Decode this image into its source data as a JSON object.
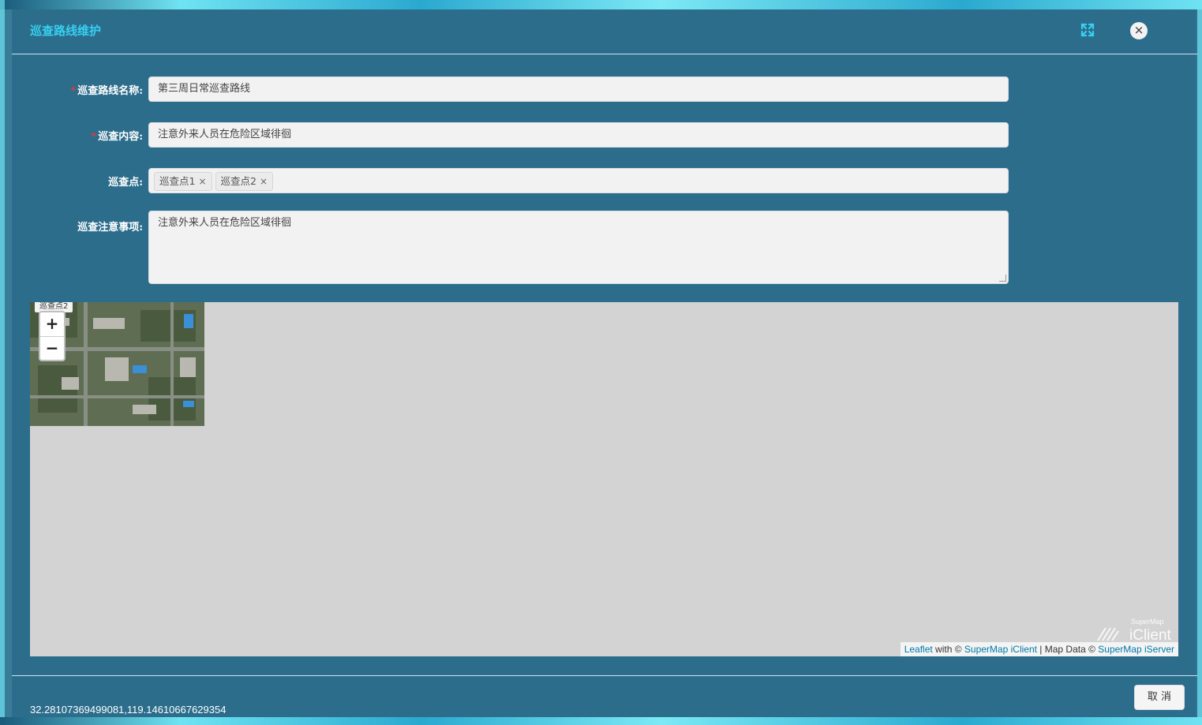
{
  "dialog": {
    "title": "巡查路线维护",
    "fullscreen_icon": "fullscreen-icon",
    "close_icon": "close-icon",
    "close_glyph": "×"
  },
  "form": {
    "route_name": {
      "label": "巡查路线名称:",
      "value": "第三周日常巡查路线",
      "required": true
    },
    "content": {
      "label": "巡查内容:",
      "value": "注意外来人员在危险区域徘徊",
      "required": true
    },
    "points": {
      "label": "巡查点:",
      "tags": [
        "巡查点1",
        "巡查点2"
      ],
      "remove_glyph": "×"
    },
    "notes": {
      "label": "巡查注意事项:",
      "value": "注意外来人员在危险区域徘徊"
    }
  },
  "map": {
    "marker_label": "巡查点2",
    "zoom_in": "+",
    "zoom_out": "−",
    "logo_small": "SuperMap",
    "logo_big": "iClient",
    "attribution": {
      "leaflet": "Leaflet",
      "with": " with © ",
      "iclient": "SuperMap iClient",
      "sep": " | Map Data © ",
      "iserver": "SuperMap iServer"
    }
  },
  "footer": {
    "coordinates": "32.28107369499081,119.14610667629354",
    "cancel_label": "取 消"
  },
  "colors": {
    "title": "#36d0f0",
    "modal_bg": "#2b6c8b",
    "required_star": "#e4393c",
    "map_bg": "#d3d3d3",
    "link": "#0078a8"
  }
}
